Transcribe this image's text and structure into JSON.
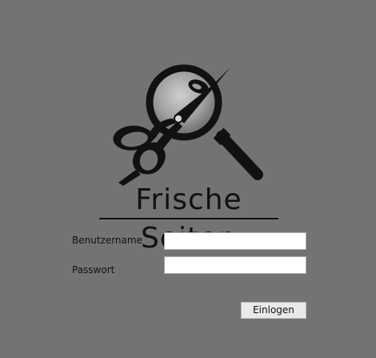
{
  "brand": {
    "title": "Frische Seiten",
    "logo_icon": "scissors-magnifier-icon"
  },
  "login_form": {
    "username_label": "Benutzername",
    "username_value": "",
    "password_label": "Passwort",
    "password_value": "",
    "submit_label": "Einlogen"
  },
  "colors": {
    "background": "#737373",
    "logo_dark": "#111111",
    "input_bg": "#ffffff",
    "button_bg": "#e9e9e9"
  }
}
